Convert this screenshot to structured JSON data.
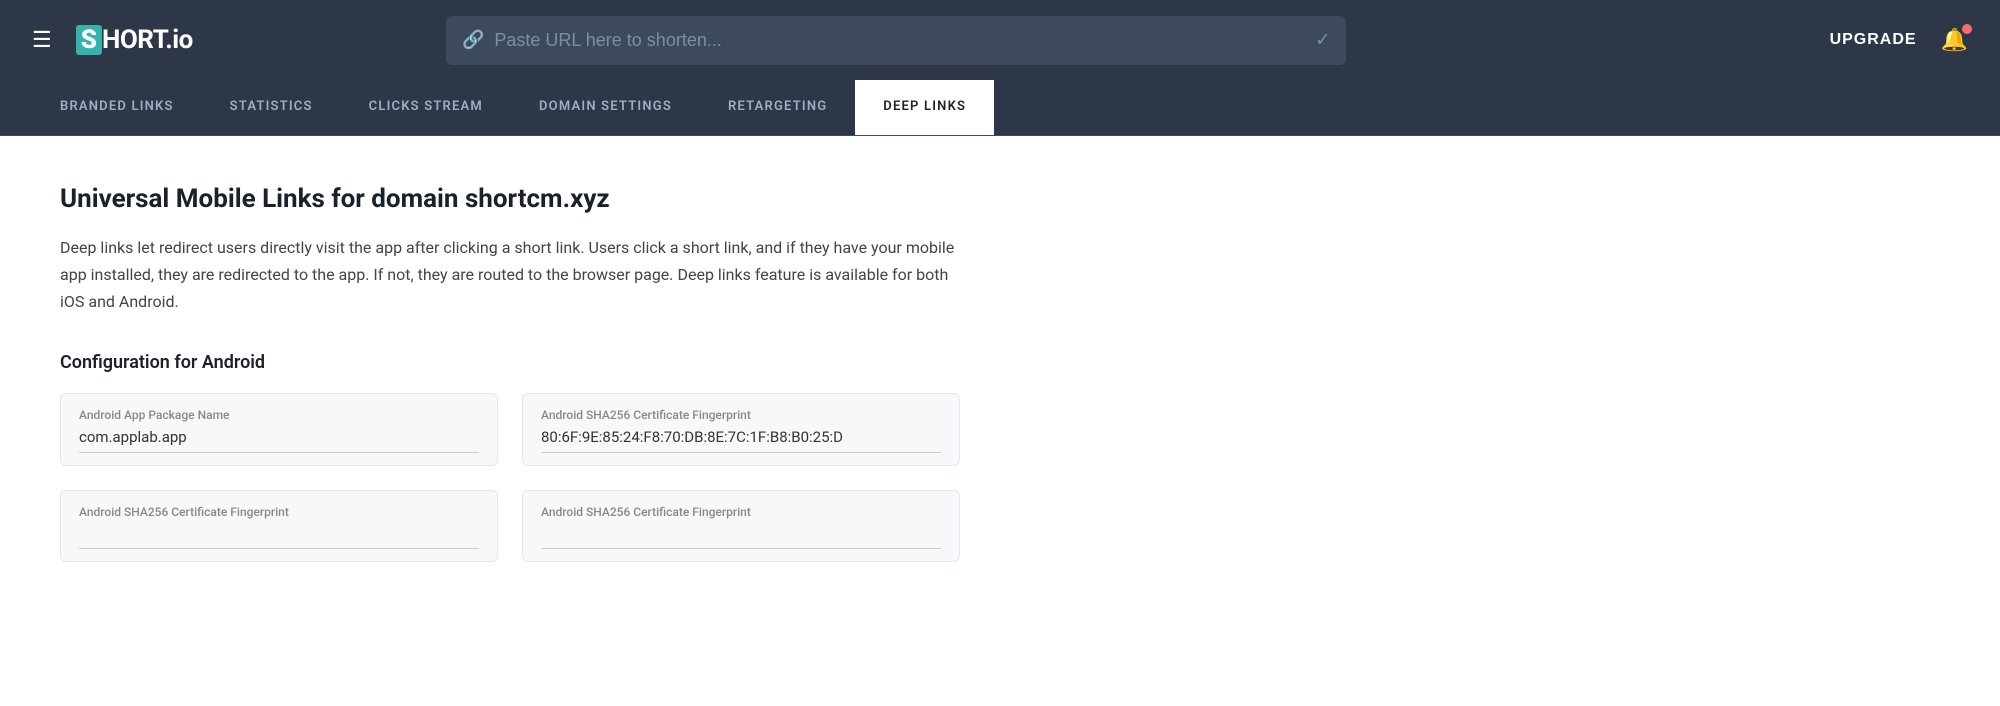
{
  "header": {
    "logo_s": "S",
    "logo_text": "HORT.io",
    "url_placeholder": "Paste URL here to shorten...",
    "upgrade_label": "UPGRADE"
  },
  "nav": {
    "tabs": [
      {
        "id": "branded-links",
        "label": "BRANDED LINKS",
        "active": false
      },
      {
        "id": "statistics",
        "label": "STATISTICS",
        "active": false
      },
      {
        "id": "clicks-stream",
        "label": "CLICKS STREAM",
        "active": false
      },
      {
        "id": "domain-settings",
        "label": "DOMAIN SETTINGS",
        "active": false
      },
      {
        "id": "retargeting",
        "label": "RETARGETING",
        "active": false
      },
      {
        "id": "deep-links",
        "label": "DEEP LINKS",
        "active": true
      }
    ]
  },
  "main": {
    "page_title": "Universal Mobile Links for domain shortcm.xyz",
    "page_description": "Deep links let redirect users directly visit the app after clicking a short link. Users click a short link, and if they have your mobile app installed, they are redirected to the app. If not, they are routed to the browser page. Deep links feature is available for both iOS and Android.",
    "section_title": "Configuration for Android",
    "fields": {
      "android_package_name_label": "Android App Package Name",
      "android_package_name_value": "com.applab.app",
      "android_sha256_label": "Android SHA256 Certificate Fingerprint",
      "android_sha256_value": "80:6F:9E:85:24:F8:70:DB:8E:7C:1F:B8:B0:25:D",
      "android_sha256_label_2": "Android SHA256 Certificate Fingerprint",
      "android_sha256_label_3": "Android SHA256 Certificate Fingerprint"
    }
  }
}
